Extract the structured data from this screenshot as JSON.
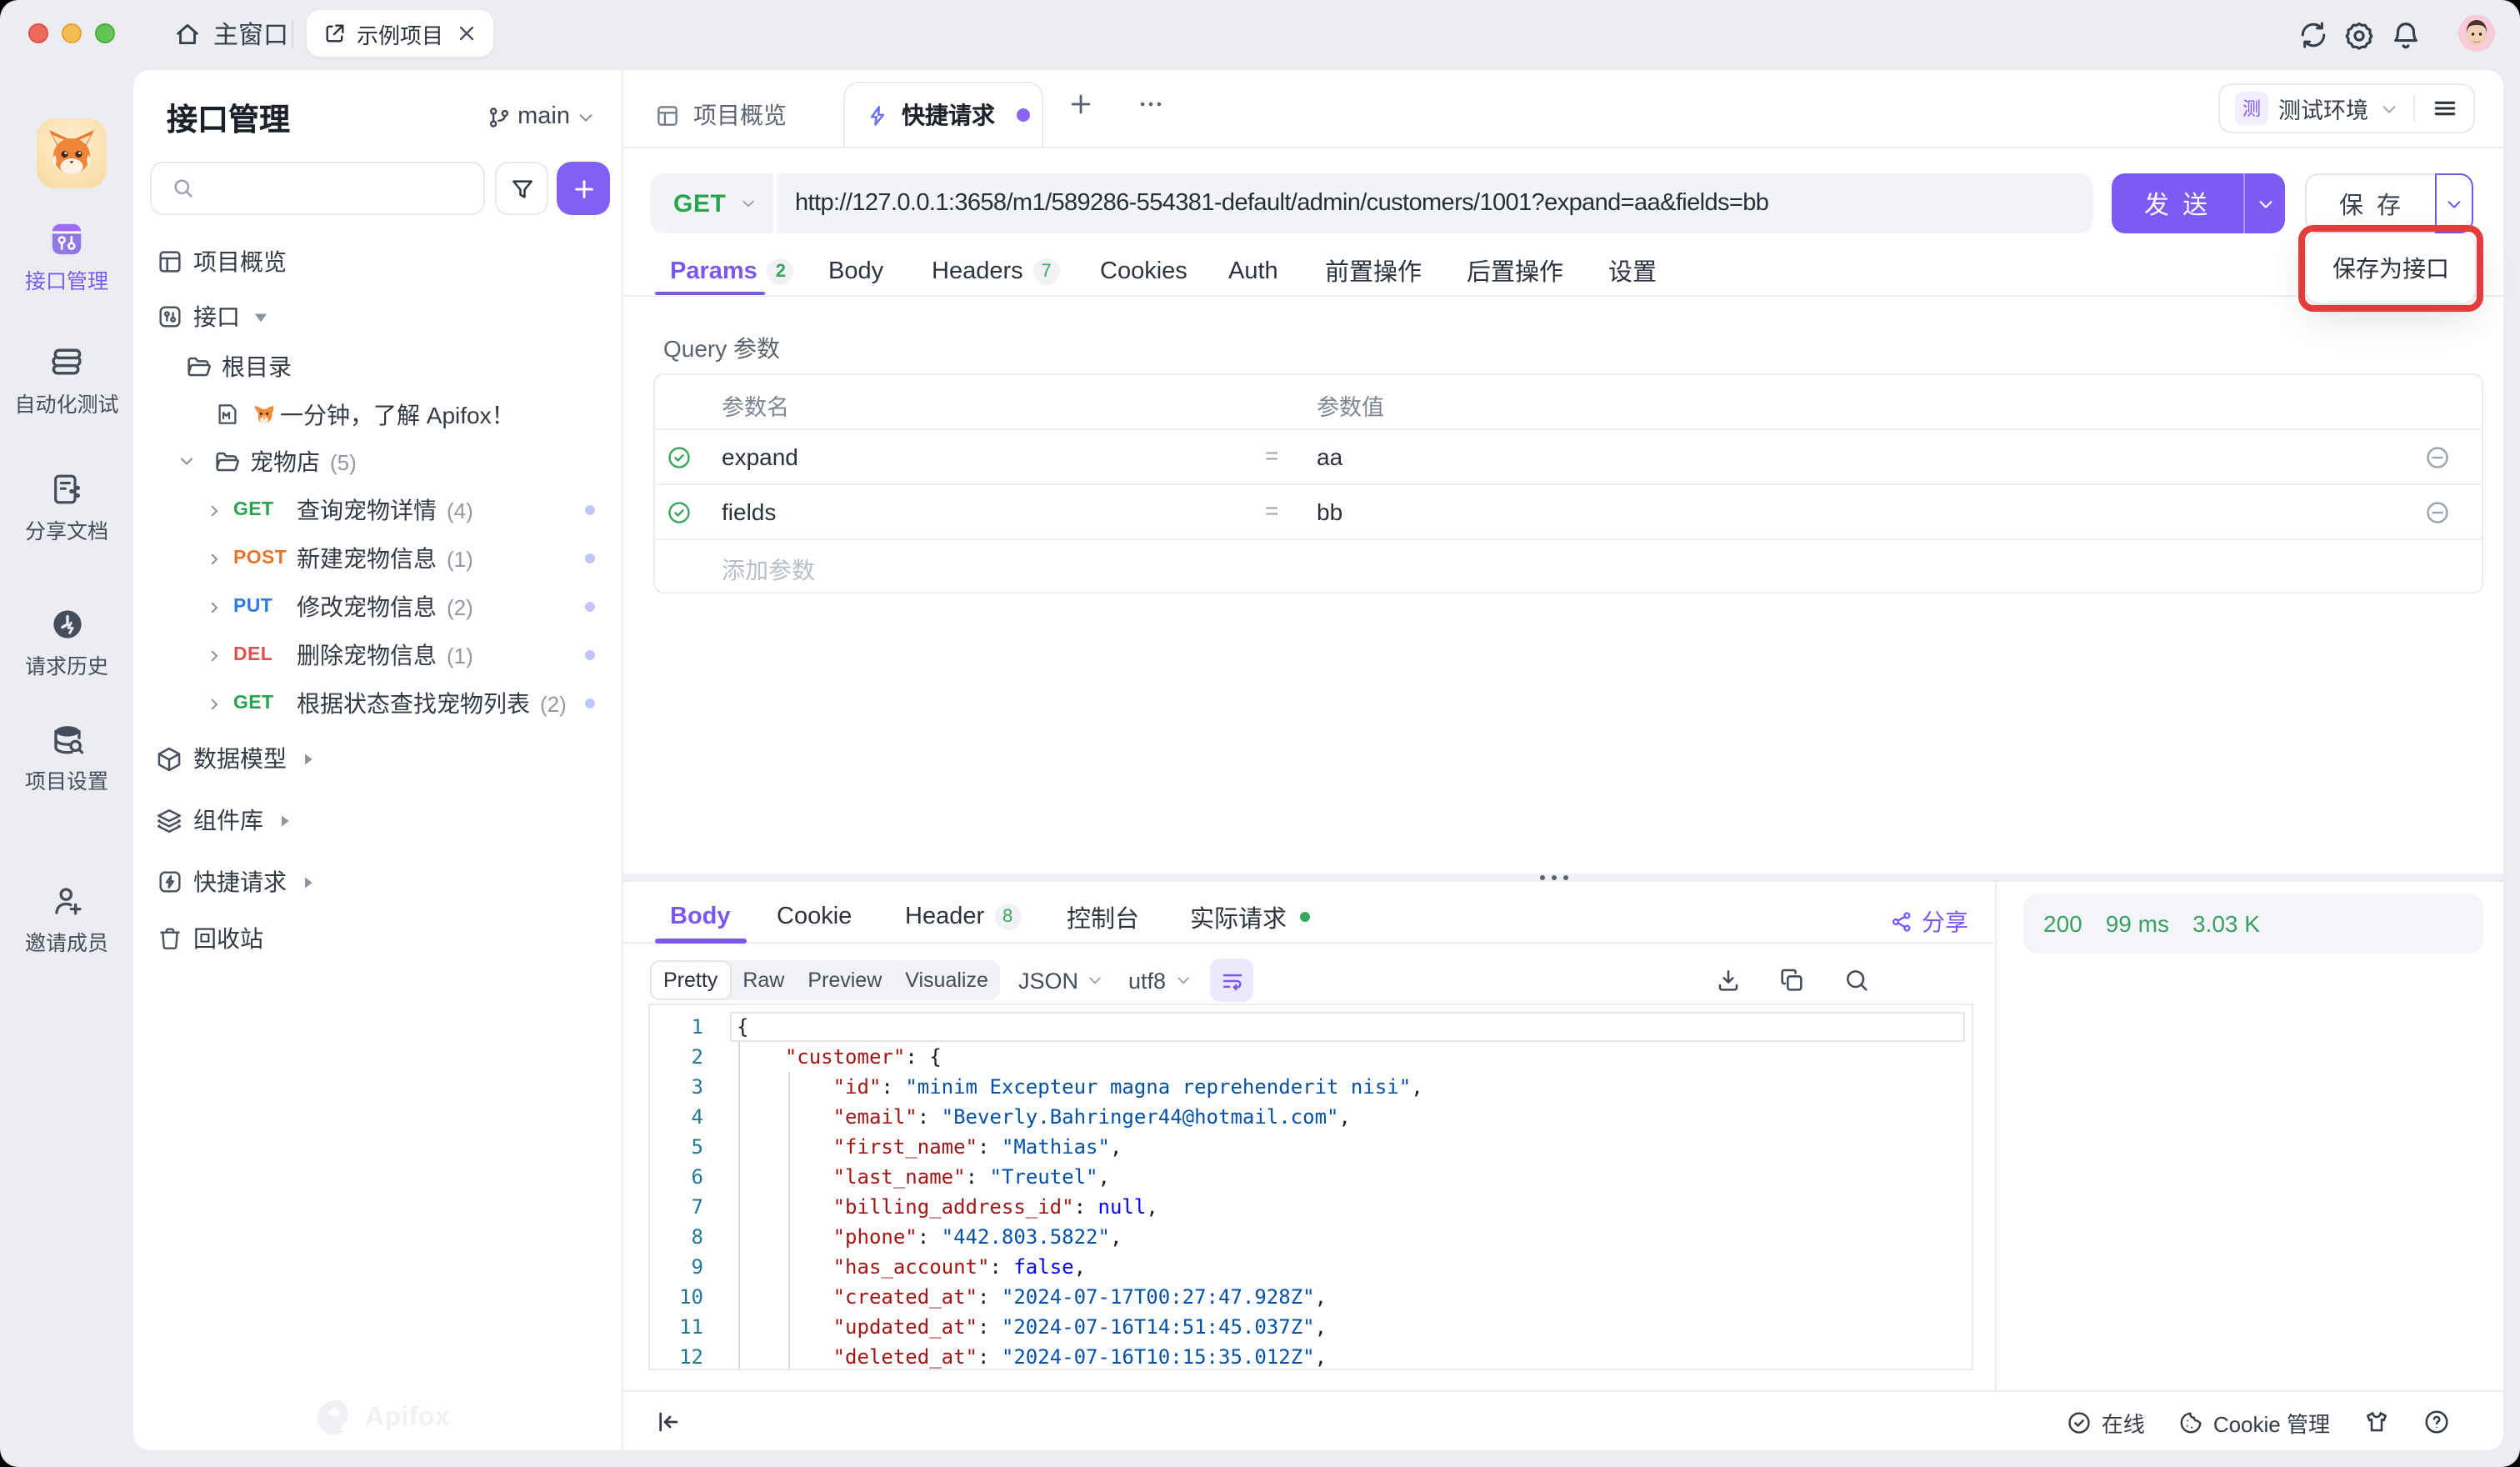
{
  "titlebar": {
    "home_tab": "主窗口",
    "project_tab": "示例项目"
  },
  "rail": {
    "items": [
      {
        "label": "接口管理"
      },
      {
        "label": "自动化测试"
      },
      {
        "label": "分享文档"
      },
      {
        "label": "请求历史"
      },
      {
        "label": "项目设置"
      },
      {
        "label": "邀请成员"
      }
    ]
  },
  "sidebar": {
    "title": "接口管理",
    "branch": "main",
    "overview": "项目概览",
    "api_section": "接口",
    "tree": [
      {
        "label": "根目录"
      },
      {
        "label": "一分钟，了解 Apifox！"
      },
      {
        "label": "宠物店",
        "count": "(5)"
      },
      {
        "method": "GET",
        "label": "查询宠物详情",
        "count": "(4)"
      },
      {
        "method": "POST",
        "label": "新建宠物信息",
        "count": "(1)"
      },
      {
        "method": "PUT",
        "label": "修改宠物信息",
        "count": "(2)"
      },
      {
        "method": "DEL",
        "label": "删除宠物信息",
        "count": "(1)"
      },
      {
        "method": "GET",
        "label": "根据状态查找宠物列表",
        "count": "(2)"
      }
    ],
    "sections": [
      {
        "label": "数据模型"
      },
      {
        "label": "组件库"
      },
      {
        "label": "快捷请求"
      },
      {
        "label": "回收站"
      }
    ],
    "watermark": "Apifox"
  },
  "maintabs": {
    "overview": "项目概览",
    "active": "快捷请求"
  },
  "env": {
    "badge": "测",
    "name": "测试环境"
  },
  "request": {
    "method": "GET",
    "url": "http://127.0.0.1:3658/m1/589286-554381-default/admin/customers/1001?expand=aa&fields=bb",
    "send": "发 送",
    "save": "保 存",
    "save_menu_item": "保存为接口",
    "tabs": [
      {
        "label": "Params",
        "badge": "2"
      },
      {
        "label": "Body"
      },
      {
        "label": "Headers",
        "badge": "7"
      },
      {
        "label": "Cookies"
      },
      {
        "label": "Auth"
      },
      {
        "label": "前置操作"
      },
      {
        "label": "后置操作"
      },
      {
        "label": "设置"
      }
    ],
    "query_title": "Query 参数",
    "table": {
      "name_header": "参数名",
      "value_header": "参数值",
      "rows": [
        {
          "name": "expand",
          "eq": "=",
          "value": "aa"
        },
        {
          "name": "fields",
          "eq": "=",
          "value": "bb"
        }
      ],
      "add_row": "添加参数"
    }
  },
  "response": {
    "tabs": [
      {
        "label": "Body"
      },
      {
        "label": "Cookie"
      },
      {
        "label": "Header",
        "badge": "8"
      },
      {
        "label": "控制台"
      },
      {
        "label": "实际请求"
      }
    ],
    "share": "分享",
    "modes": [
      "Pretty",
      "Raw",
      "Preview",
      "Visualize"
    ],
    "lang": "JSON",
    "encoding": "utf8",
    "status": {
      "code": "200",
      "time": "99 ms",
      "size": "3.03 K"
    },
    "code": {
      "lines": [
        {
          "n": "1",
          "tokens": [
            [
              "p",
              "{"
            ]
          ]
        },
        {
          "n": "2",
          "tokens": [
            [
              "p",
              "    "
            ],
            [
              "key",
              "\"customer\""
            ],
            [
              "p",
              ": {"
            ]
          ]
        },
        {
          "n": "3",
          "tokens": [
            [
              "p",
              "        "
            ],
            [
              "key",
              "\"id\""
            ],
            [
              "p",
              ": "
            ],
            [
              "str",
              "\"minim Excepteur magna reprehenderit nisi\""
            ],
            [
              "p",
              ","
            ]
          ]
        },
        {
          "n": "4",
          "tokens": [
            [
              "p",
              "        "
            ],
            [
              "key",
              "\"email\""
            ],
            [
              "p",
              ": "
            ],
            [
              "str",
              "\"Beverly.Bahringer44@hotmail.com\""
            ],
            [
              "p",
              ","
            ]
          ]
        },
        {
          "n": "5",
          "tokens": [
            [
              "p",
              "        "
            ],
            [
              "key",
              "\"first_name\""
            ],
            [
              "p",
              ": "
            ],
            [
              "str",
              "\"Mathias\""
            ],
            [
              "p",
              ","
            ]
          ]
        },
        {
          "n": "6",
          "tokens": [
            [
              "p",
              "        "
            ],
            [
              "key",
              "\"last_name\""
            ],
            [
              "p",
              ": "
            ],
            [
              "str",
              "\"Treutel\""
            ],
            [
              "p",
              ","
            ]
          ]
        },
        {
          "n": "7",
          "tokens": [
            [
              "p",
              "        "
            ],
            [
              "key",
              "\"billing_address_id\""
            ],
            [
              "p",
              ": "
            ],
            [
              "kw",
              "null"
            ],
            [
              "p",
              ","
            ]
          ]
        },
        {
          "n": "8",
          "tokens": [
            [
              "p",
              "        "
            ],
            [
              "key",
              "\"phone\""
            ],
            [
              "p",
              ": "
            ],
            [
              "str",
              "\"442.803.5822\""
            ],
            [
              "p",
              ","
            ]
          ]
        },
        {
          "n": "9",
          "tokens": [
            [
              "p",
              "        "
            ],
            [
              "key",
              "\"has_account\""
            ],
            [
              "p",
              ": "
            ],
            [
              "kw",
              "false"
            ],
            [
              "p",
              ","
            ]
          ]
        },
        {
          "n": "10",
          "tokens": [
            [
              "p",
              "        "
            ],
            [
              "key",
              "\"created_at\""
            ],
            [
              "p",
              ": "
            ],
            [
              "str",
              "\"2024-07-17T00:27:47.928Z\""
            ],
            [
              "p",
              ","
            ]
          ]
        },
        {
          "n": "11",
          "tokens": [
            [
              "p",
              "        "
            ],
            [
              "key",
              "\"updated_at\""
            ],
            [
              "p",
              ": "
            ],
            [
              "str",
              "\"2024-07-16T14:51:45.037Z\""
            ],
            [
              "p",
              ","
            ]
          ]
        },
        {
          "n": "12",
          "tokens": [
            [
              "p",
              "        "
            ],
            [
              "key",
              "\"deleted_at\""
            ],
            [
              "p",
              ": "
            ],
            [
              "str",
              "\"2024-07-16T10:15:35.012Z\""
            ],
            [
              "p",
              ","
            ]
          ]
        }
      ]
    }
  },
  "statusbar": {
    "online": "在线",
    "cookie": "Cookie 管理"
  }
}
